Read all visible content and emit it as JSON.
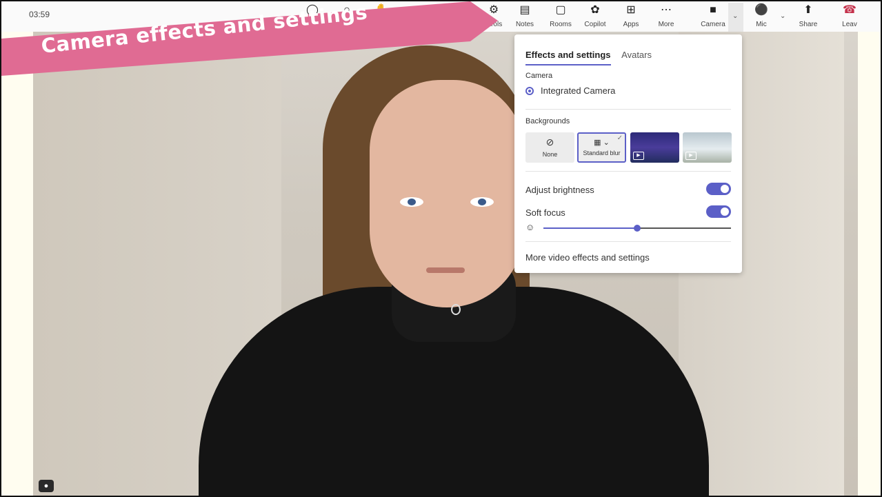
{
  "timer": "03:59",
  "banner": {
    "text": "Camera effects and settings",
    "color": "#e06b93"
  },
  "toolbar": {
    "items": [
      {
        "label": "",
        "icon": "chat-icon"
      },
      {
        "label": "",
        "icon": "people-icon"
      },
      {
        "label": "",
        "icon": "raise-hand-icon"
      },
      {
        "label": "ntrols",
        "icon": "controls-icon"
      },
      {
        "label": "Notes",
        "icon": "notes-icon"
      },
      {
        "label": "Rooms",
        "icon": "rooms-icon"
      },
      {
        "label": "Copilot",
        "icon": "copilot-icon"
      },
      {
        "label": "Apps",
        "icon": "apps-icon"
      },
      {
        "label": "More",
        "icon": "more-icon"
      },
      {
        "label": "Camera",
        "icon": "camera-icon"
      },
      {
        "label": "Mic",
        "icon": "mic-icon"
      },
      {
        "label": "Share",
        "icon": "share-icon"
      },
      {
        "label": "Leav",
        "icon": "leave-icon"
      }
    ]
  },
  "panel": {
    "tabs": [
      "Effects and settings",
      "Avatars"
    ],
    "camera_label": "Camera",
    "camera_device": "Integrated Camera",
    "backgrounds_label": "Backgrounds",
    "bg_none": "None",
    "bg_blur": "Standard blur",
    "adjust_brightness": "Adjust brightness",
    "adjust_brightness_on": true,
    "soft_focus": "Soft focus",
    "soft_focus_on": true,
    "soft_focus_level": 0.5,
    "more_link": "More video effects and settings"
  },
  "colors": {
    "accent": "#5b5fc7",
    "leave": "#c4314b"
  }
}
